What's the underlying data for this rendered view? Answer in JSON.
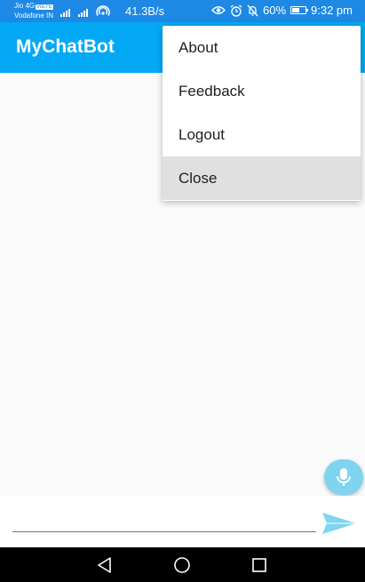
{
  "status_bar": {
    "carrier_line1": "Jio 4G",
    "carrier_tag": "VoLTE",
    "carrier_line2": "Vodafone IN",
    "speed": "41.3B/s",
    "battery_percent_text": "60%",
    "battery_level": 0.6,
    "time": "9:32 pm"
  },
  "app_bar": {
    "title": "MyChatBot"
  },
  "menu": {
    "items": [
      {
        "label": "About"
      },
      {
        "label": "Feedback"
      },
      {
        "label": "Logout"
      },
      {
        "label": "Close"
      }
    ]
  },
  "chat_input": {
    "value": "",
    "placeholder": ""
  },
  "icons": {
    "mic": "microphone-icon",
    "send": "send-icon",
    "back": "back-triangle-icon",
    "home": "home-circle-icon",
    "recents": "recents-square-icon"
  },
  "colors": {
    "status_bar": "#1e88e5",
    "app_bar": "#03a9f4",
    "fab": "#7fd4f0",
    "send": "#7fd4f0",
    "menu_pressed": "#e0e0e0"
  }
}
